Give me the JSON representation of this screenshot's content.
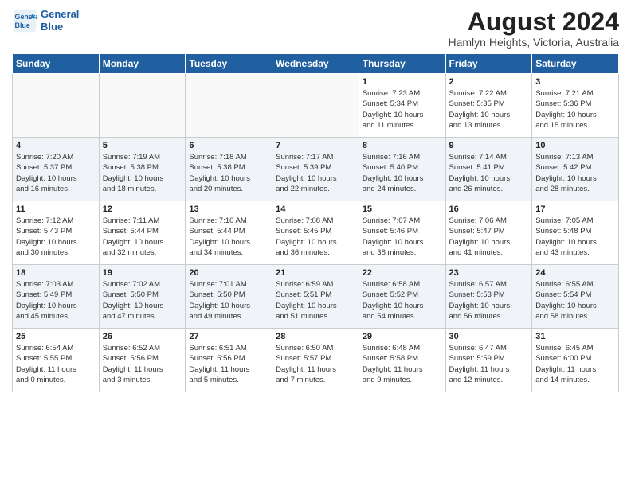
{
  "header": {
    "logo_line1": "General",
    "logo_line2": "Blue",
    "month_year": "August 2024",
    "location": "Hamlyn Heights, Victoria, Australia"
  },
  "weekdays": [
    "Sunday",
    "Monday",
    "Tuesday",
    "Wednesday",
    "Thursday",
    "Friday",
    "Saturday"
  ],
  "weeks": [
    [
      {
        "day": "",
        "info": ""
      },
      {
        "day": "",
        "info": ""
      },
      {
        "day": "",
        "info": ""
      },
      {
        "day": "",
        "info": ""
      },
      {
        "day": "1",
        "info": "Sunrise: 7:23 AM\nSunset: 5:34 PM\nDaylight: 10 hours\nand 11 minutes."
      },
      {
        "day": "2",
        "info": "Sunrise: 7:22 AM\nSunset: 5:35 PM\nDaylight: 10 hours\nand 13 minutes."
      },
      {
        "day": "3",
        "info": "Sunrise: 7:21 AM\nSunset: 5:36 PM\nDaylight: 10 hours\nand 15 minutes."
      }
    ],
    [
      {
        "day": "4",
        "info": "Sunrise: 7:20 AM\nSunset: 5:37 PM\nDaylight: 10 hours\nand 16 minutes."
      },
      {
        "day": "5",
        "info": "Sunrise: 7:19 AM\nSunset: 5:38 PM\nDaylight: 10 hours\nand 18 minutes."
      },
      {
        "day": "6",
        "info": "Sunrise: 7:18 AM\nSunset: 5:38 PM\nDaylight: 10 hours\nand 20 minutes."
      },
      {
        "day": "7",
        "info": "Sunrise: 7:17 AM\nSunset: 5:39 PM\nDaylight: 10 hours\nand 22 minutes."
      },
      {
        "day": "8",
        "info": "Sunrise: 7:16 AM\nSunset: 5:40 PM\nDaylight: 10 hours\nand 24 minutes."
      },
      {
        "day": "9",
        "info": "Sunrise: 7:14 AM\nSunset: 5:41 PM\nDaylight: 10 hours\nand 26 minutes."
      },
      {
        "day": "10",
        "info": "Sunrise: 7:13 AM\nSunset: 5:42 PM\nDaylight: 10 hours\nand 28 minutes."
      }
    ],
    [
      {
        "day": "11",
        "info": "Sunrise: 7:12 AM\nSunset: 5:43 PM\nDaylight: 10 hours\nand 30 minutes."
      },
      {
        "day": "12",
        "info": "Sunrise: 7:11 AM\nSunset: 5:44 PM\nDaylight: 10 hours\nand 32 minutes."
      },
      {
        "day": "13",
        "info": "Sunrise: 7:10 AM\nSunset: 5:44 PM\nDaylight: 10 hours\nand 34 minutes."
      },
      {
        "day": "14",
        "info": "Sunrise: 7:08 AM\nSunset: 5:45 PM\nDaylight: 10 hours\nand 36 minutes."
      },
      {
        "day": "15",
        "info": "Sunrise: 7:07 AM\nSunset: 5:46 PM\nDaylight: 10 hours\nand 38 minutes."
      },
      {
        "day": "16",
        "info": "Sunrise: 7:06 AM\nSunset: 5:47 PM\nDaylight: 10 hours\nand 41 minutes."
      },
      {
        "day": "17",
        "info": "Sunrise: 7:05 AM\nSunset: 5:48 PM\nDaylight: 10 hours\nand 43 minutes."
      }
    ],
    [
      {
        "day": "18",
        "info": "Sunrise: 7:03 AM\nSunset: 5:49 PM\nDaylight: 10 hours\nand 45 minutes."
      },
      {
        "day": "19",
        "info": "Sunrise: 7:02 AM\nSunset: 5:50 PM\nDaylight: 10 hours\nand 47 minutes."
      },
      {
        "day": "20",
        "info": "Sunrise: 7:01 AM\nSunset: 5:50 PM\nDaylight: 10 hours\nand 49 minutes."
      },
      {
        "day": "21",
        "info": "Sunrise: 6:59 AM\nSunset: 5:51 PM\nDaylight: 10 hours\nand 51 minutes."
      },
      {
        "day": "22",
        "info": "Sunrise: 6:58 AM\nSunset: 5:52 PM\nDaylight: 10 hours\nand 54 minutes."
      },
      {
        "day": "23",
        "info": "Sunrise: 6:57 AM\nSunset: 5:53 PM\nDaylight: 10 hours\nand 56 minutes."
      },
      {
        "day": "24",
        "info": "Sunrise: 6:55 AM\nSunset: 5:54 PM\nDaylight: 10 hours\nand 58 minutes."
      }
    ],
    [
      {
        "day": "25",
        "info": "Sunrise: 6:54 AM\nSunset: 5:55 PM\nDaylight: 11 hours\nand 0 minutes."
      },
      {
        "day": "26",
        "info": "Sunrise: 6:52 AM\nSunset: 5:56 PM\nDaylight: 11 hours\nand 3 minutes."
      },
      {
        "day": "27",
        "info": "Sunrise: 6:51 AM\nSunset: 5:56 PM\nDaylight: 11 hours\nand 5 minutes."
      },
      {
        "day": "28",
        "info": "Sunrise: 6:50 AM\nSunset: 5:57 PM\nDaylight: 11 hours\nand 7 minutes."
      },
      {
        "day": "29",
        "info": "Sunrise: 6:48 AM\nSunset: 5:58 PM\nDaylight: 11 hours\nand 9 minutes."
      },
      {
        "day": "30",
        "info": "Sunrise: 6:47 AM\nSunset: 5:59 PM\nDaylight: 11 hours\nand 12 minutes."
      },
      {
        "day": "31",
        "info": "Sunrise: 6:45 AM\nSunset: 6:00 PM\nDaylight: 11 hours\nand 14 minutes."
      }
    ]
  ]
}
